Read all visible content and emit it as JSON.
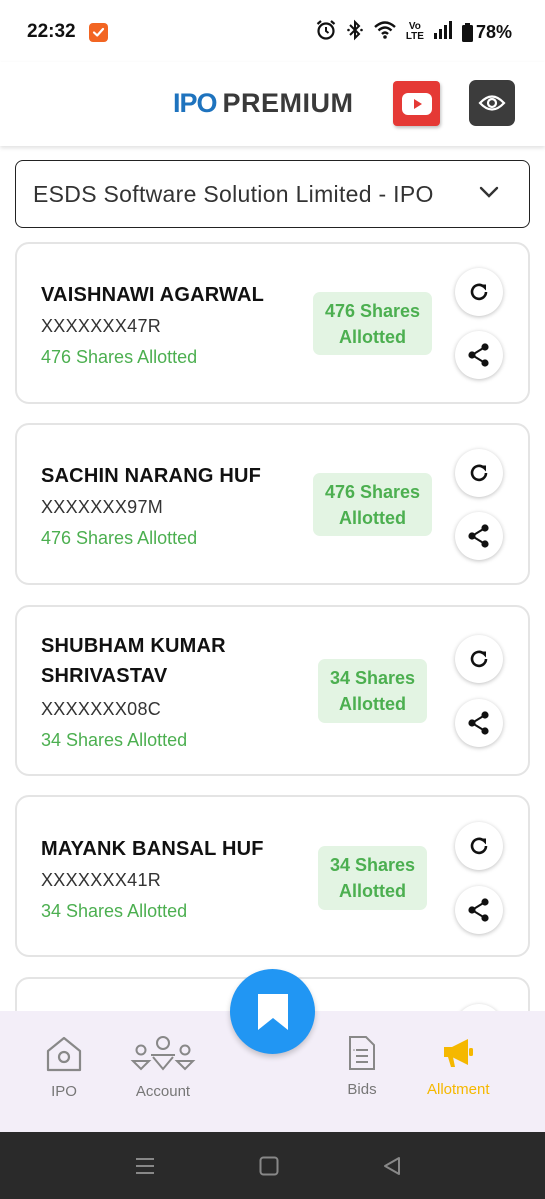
{
  "status_bar": {
    "time": "22:32",
    "battery": "78%",
    "icons": [
      "alarm-icon",
      "bluetooth-icon",
      "wifi-icon",
      "volte-icon",
      "signal-icon",
      "battery-icon"
    ]
  },
  "header": {
    "logo_ipo": "IPO",
    "logo_premium": "PREMIUM",
    "youtube_icon": "youtube-icon",
    "eye_icon": "eye-icon"
  },
  "ipo_selector": {
    "selected": "ESDS Software Solution Limited - IPO"
  },
  "allotments": [
    {
      "name": "VAISHNAWI AGARWAL",
      "pan": "XXXXXXX47R",
      "status": "476 Shares Allotted",
      "badge_line1": "476 Shares",
      "badge_line2": "Allotted"
    },
    {
      "name": "SACHIN NARANG HUF",
      "pan": "XXXXXXX97M",
      "status": "476 Shares Allotted",
      "badge_line1": "476 Shares",
      "badge_line2": "Allotted"
    },
    {
      "name_line1": "SHUBHAM KUMAR",
      "name_line2": "SHRIVASTAV",
      "pan": "XXXXXXX08C",
      "status": "34 Shares Allotted",
      "badge_line1": "34 Shares",
      "badge_line2": "Allotted"
    },
    {
      "name": "MAYANK BANSAL HUF",
      "pan": "XXXXXXX41R",
      "status": "34 Shares Allotted",
      "badge_line1": "34 Shares",
      "badge_line2": "Allotted"
    }
  ],
  "bottom_nav": {
    "items": [
      {
        "label": "IPO",
        "icon": "home-icon"
      },
      {
        "label": "Account",
        "icon": "accounts-icon"
      },
      {
        "label": "Bids",
        "icon": "document-icon"
      },
      {
        "label": "Allotment",
        "icon": "megaphone-icon"
      }
    ],
    "active": "Allotment",
    "fab_icon": "bookmark-icon"
  },
  "colors": {
    "accent_green": "#4caf50",
    "badge_bg": "#e3f4e3",
    "fab_blue": "#2196f3",
    "active_nav": "#f5b800",
    "youtube_red": "#e53935"
  }
}
